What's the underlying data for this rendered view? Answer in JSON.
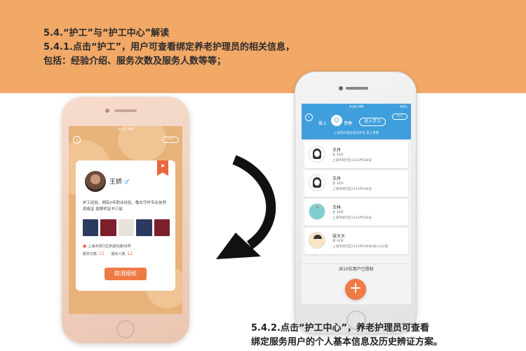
{
  "intro": {
    "line1": "5.4.“护工”与“护工中心”解读",
    "line2": "5.4.1.点击“护工”，用户可查看绑定养老护理员的相关信息，",
    "line3": "包括：经验介绍、服务次数及服务人数等等；"
  },
  "left_phone": {
    "status_time": "4:00 PM",
    "back_icon": "‹",
    "menu_icon": "•••",
    "badge_icon": "★",
    "nurse_name": "王娇",
    "gender_icon": "♂",
    "description": "护工经验，拥有5年职业经验，敬业守时专业技师资格证 按摩师证书三级",
    "address": "上海市闵行区新建东路58弄",
    "service_count_label": "服务次数",
    "service_count": "12",
    "service_people_label": "服务人数",
    "service_people": "12",
    "cancel_button": "取消授权"
  },
  "right_phone": {
    "status_time": "4:00 PM",
    "battery": "50%",
    "back_icon": "‹",
    "menu_icon": "•••",
    "header_left": "掌上",
    "header_avatar_icon": "☺",
    "header_right": "青春",
    "learn_button": "进入学习",
    "header_sub": "上海市护理员培训平台 掌上青春",
    "users": [
      {
        "name": "王丹",
        "info": "女 28岁",
        "addr": "上海市闵行区2233弄569号"
      },
      {
        "name": "王丹",
        "info": "女 28岁",
        "addr": "上海市闵行区2233弄569号"
      },
      {
        "name": "王林",
        "info": "女 28岁",
        "addr": "上海市闵行区2233弄569号"
      },
      {
        "name": "张大大",
        "info": "男 28岁",
        "addr": "上海市闵行区2233弄569号6栋1202室"
      }
    ],
    "count_line": "共10位用户已授权",
    "add_icon": "+"
  },
  "footer": {
    "line1": "5.4.2.点击“护工中心”，养老护理员可查看",
    "line2": "绑定服务用户的个人基本信息及历史辨证方案。"
  },
  "colors": {
    "band": "#f2a866",
    "accent": "#ef7a45",
    "header_blue": "#3f9fdc"
  }
}
